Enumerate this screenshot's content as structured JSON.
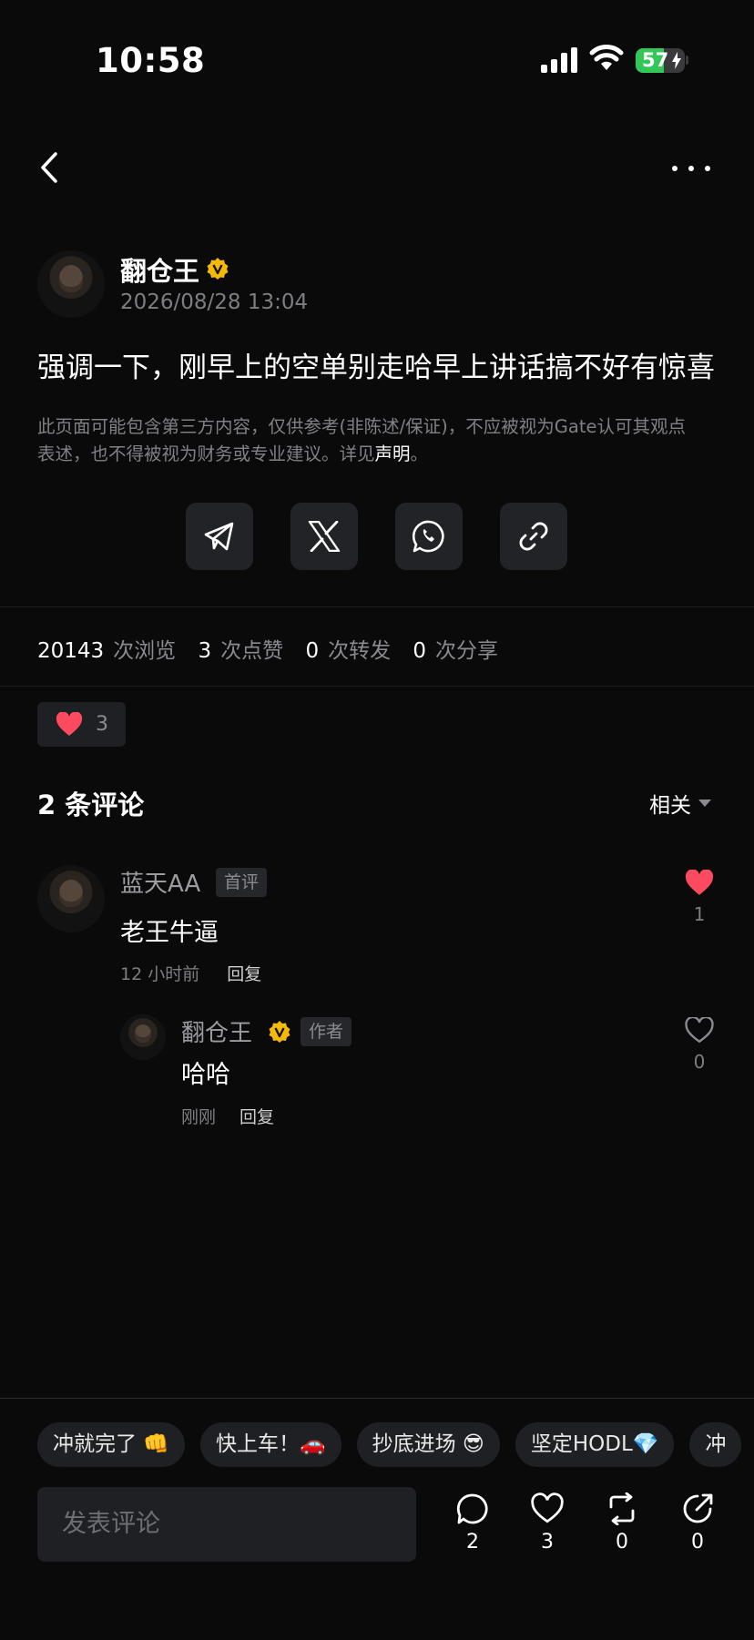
{
  "status_bar": {
    "time": "10:58",
    "battery": "57",
    "battery_level": 0.57
  },
  "post": {
    "author": "翻仓王",
    "timestamp": "2026/08/28 13:04",
    "body": "强调一下，刚早上的空单别走哈早上讲话搞不好有惊喜",
    "disclaimer_line1": "此页面可能包含第三方内容，仅供参考(非陈述/保证)，不应被视为Gate认可其观点",
    "disclaimer_line2": "表述，也不得被视为财务或专业建议。详见",
    "disclaimer_link": "声明",
    "disclaimer_end": "。"
  },
  "share_icons": [
    "telegram-icon",
    "x-icon",
    "whatsapp-icon",
    "link-icon"
  ],
  "stats": {
    "views": "20143",
    "views_label": "次浏览",
    "likes": "3",
    "likes_label": "次点赞",
    "reposts": "0",
    "reposts_label": "次转发",
    "shares": "0",
    "shares_label": "次分享"
  },
  "like_chip": {
    "count": "3"
  },
  "comments": {
    "header": "2 条评论",
    "sort": "相关",
    "items": [
      {
        "name": "蓝天AA",
        "tag": "首评",
        "text": "老王牛逼",
        "time": "12 小时前",
        "reply": "回复",
        "likes": "1",
        "liked": true
      }
    ],
    "replies": [
      {
        "name": "翻仓王",
        "tag": "作者",
        "text": "哈哈",
        "time": "刚刚",
        "reply": "回复",
        "likes": "0",
        "liked": false
      }
    ]
  },
  "quick_replies": [
    "冲就完了 👊",
    "快上车！🚗",
    "抄底进场 😎",
    "坚定HODL💎",
    "冲"
  ],
  "composer": {
    "placeholder": "发表评论",
    "comments_count": "2",
    "likes_count": "3",
    "reposts_count": "0",
    "shares_count": "0"
  },
  "colors": {
    "background": "#0a0a0b",
    "like_red": "#fe4a5f",
    "verified_gold": "#f5b90a",
    "battery_green": "#33c759"
  }
}
